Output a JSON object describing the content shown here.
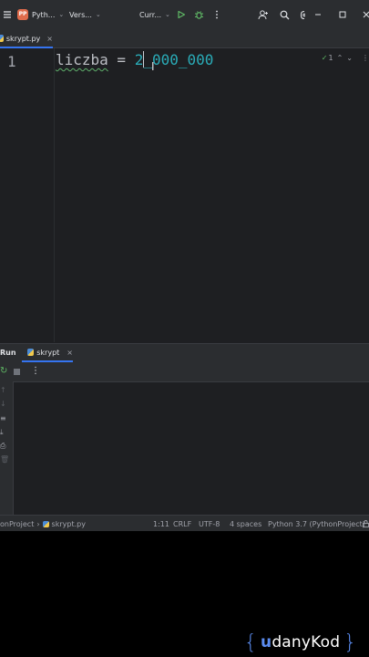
{
  "titlebar": {
    "project_badge": "PP",
    "project_name": "Pyth...",
    "vcs_label": "Vers...",
    "run_config": "Curr..."
  },
  "tabs": [
    {
      "label": "skrypt.py"
    }
  ],
  "editor": {
    "line_number": "1",
    "code_ident": "liczba",
    "code_op": " = ",
    "code_num_before_caret": "2",
    "code_num_after_caret": "_000_000",
    "inspection_count": "1"
  },
  "run_panel": {
    "title": "Run",
    "tab_label": "skrypt"
  },
  "statusbar": {
    "breadcrumb_project": "onProject",
    "breadcrumb_file": "skrypt.py",
    "position": "1:11",
    "line_sep": "CRLF",
    "encoding": "UTF-8",
    "indent": "4 spaces",
    "interpreter": "Python 3.7 (PythonProject)"
  },
  "watermark": {
    "brace_open": "{",
    "u_mark": "u",
    "text": "danyKod",
    "brace_close": "}"
  },
  "colors": {
    "accent": "#3574f0",
    "number": "#2aacb8",
    "run_green": "#5fb865",
    "badge": "#e06c4c"
  }
}
